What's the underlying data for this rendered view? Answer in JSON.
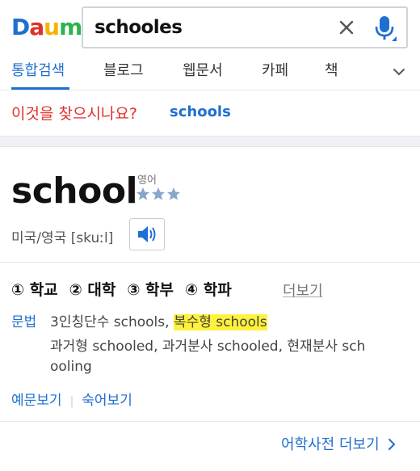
{
  "logo": {
    "letters": [
      "D",
      "a",
      "u",
      "m"
    ],
    "colors": [
      "#1f6fd0",
      "#e0302a",
      "#f5b400",
      "#2fb24c"
    ]
  },
  "search": {
    "value": "schooles"
  },
  "icons": {
    "clear": "close-icon",
    "mic": "microphone-icon",
    "expand": "chevron-down-icon",
    "speaker": "speaker-icon",
    "rating": "star-icon"
  },
  "tabs": [
    {
      "label": "통합검색",
      "active": true
    },
    {
      "label": "블로그"
    },
    {
      "label": "웹문서"
    },
    {
      "label": "카페"
    },
    {
      "label": "책"
    }
  ],
  "suggestion": {
    "question": "이것을 찾으시나요?",
    "term": "schools"
  },
  "entry": {
    "word": "school",
    "language": "영어",
    "stars": 3,
    "pronunciation": "미국/영국 [skuːl]",
    "meanings": [
      "① 학교",
      "② 대학",
      "③ 학부",
      "④ 학파"
    ],
    "more_meanings": "더보기",
    "grammar": {
      "label": "문법",
      "line1_prefix": "3인칭단수 schools, ",
      "line1_highlight": "복수형 schools",
      "line2": "과거형 schooled, 과거분사 schooled, 현재분사 sch",
      "line3": "ooling"
    },
    "links": {
      "examples": "예문보기",
      "idioms": "숙어보기"
    }
  },
  "dictionary_more": "어학사전 더보기",
  "colors": {
    "accent": "#1f6fd0",
    "suggest_red": "#e0302a",
    "highlight": "#fff23a"
  }
}
